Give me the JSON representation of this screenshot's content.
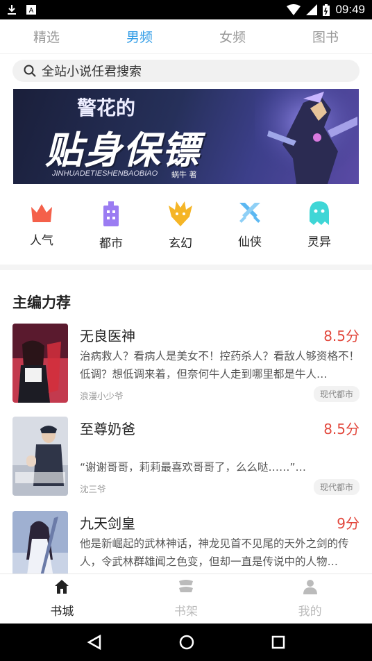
{
  "status_bar": {
    "time": "09:49"
  },
  "tabs": [
    {
      "label": "精选"
    },
    {
      "label": "男频"
    },
    {
      "label": "女频"
    },
    {
      "label": "图书"
    }
  ],
  "active_tab": "男频",
  "search": {
    "placeholder": "全站小说任君搜索"
  },
  "banner": {
    "title_small": "警花的",
    "title_big": "贴身保镖",
    "subtitle": "JINHUADETIESHENBAOBIAO",
    "author_mark": "蜗牛 著"
  },
  "categories": [
    {
      "label": "人气",
      "icon": "crown-icon",
      "color": "#f4604a"
    },
    {
      "label": "都市",
      "icon": "building-icon",
      "color": "#9b7cf2"
    },
    {
      "label": "玄幻",
      "icon": "dragon-icon",
      "color": "#f5b526"
    },
    {
      "label": "仙侠",
      "icon": "swords-icon",
      "color": "#5cb8f2"
    },
    {
      "label": "灵异",
      "icon": "ghost-icon",
      "color": "#3fd6d6"
    }
  ],
  "section": {
    "title": "主编力荐"
  },
  "books": [
    {
      "title": "无良医神",
      "score": "8.5分",
      "description": "治病救人？看病人是美女不！控药杀人？看敌人够资格不！低调？想低调来着，但奈何牛人走到哪里都是牛人…",
      "author": "浪漫小少爷",
      "tag": "现代都市"
    },
    {
      "title": "至尊奶爸",
      "score": "8.5分",
      "description": "“谢谢哥哥，莉莉最喜欢哥哥了，么么哒……”…",
      "author": "沈三爷",
      "tag": "现代都市"
    },
    {
      "title": "九天剑皇",
      "score": "9分",
      "description": "他是新崛起的武林神话，神龙见首不见尾的天外之剑的传人，令武林群雄闻之色变，但却一直是传说中的人物…",
      "author": "",
      "tag": ""
    }
  ],
  "bottom_nav": [
    {
      "label": "书城",
      "icon": "home-icon"
    },
    {
      "label": "书架",
      "icon": "bookshelf-icon"
    },
    {
      "label": "我的",
      "icon": "user-icon"
    }
  ],
  "colors": {
    "accent": "#2e9be6",
    "score": "#e2483d"
  }
}
